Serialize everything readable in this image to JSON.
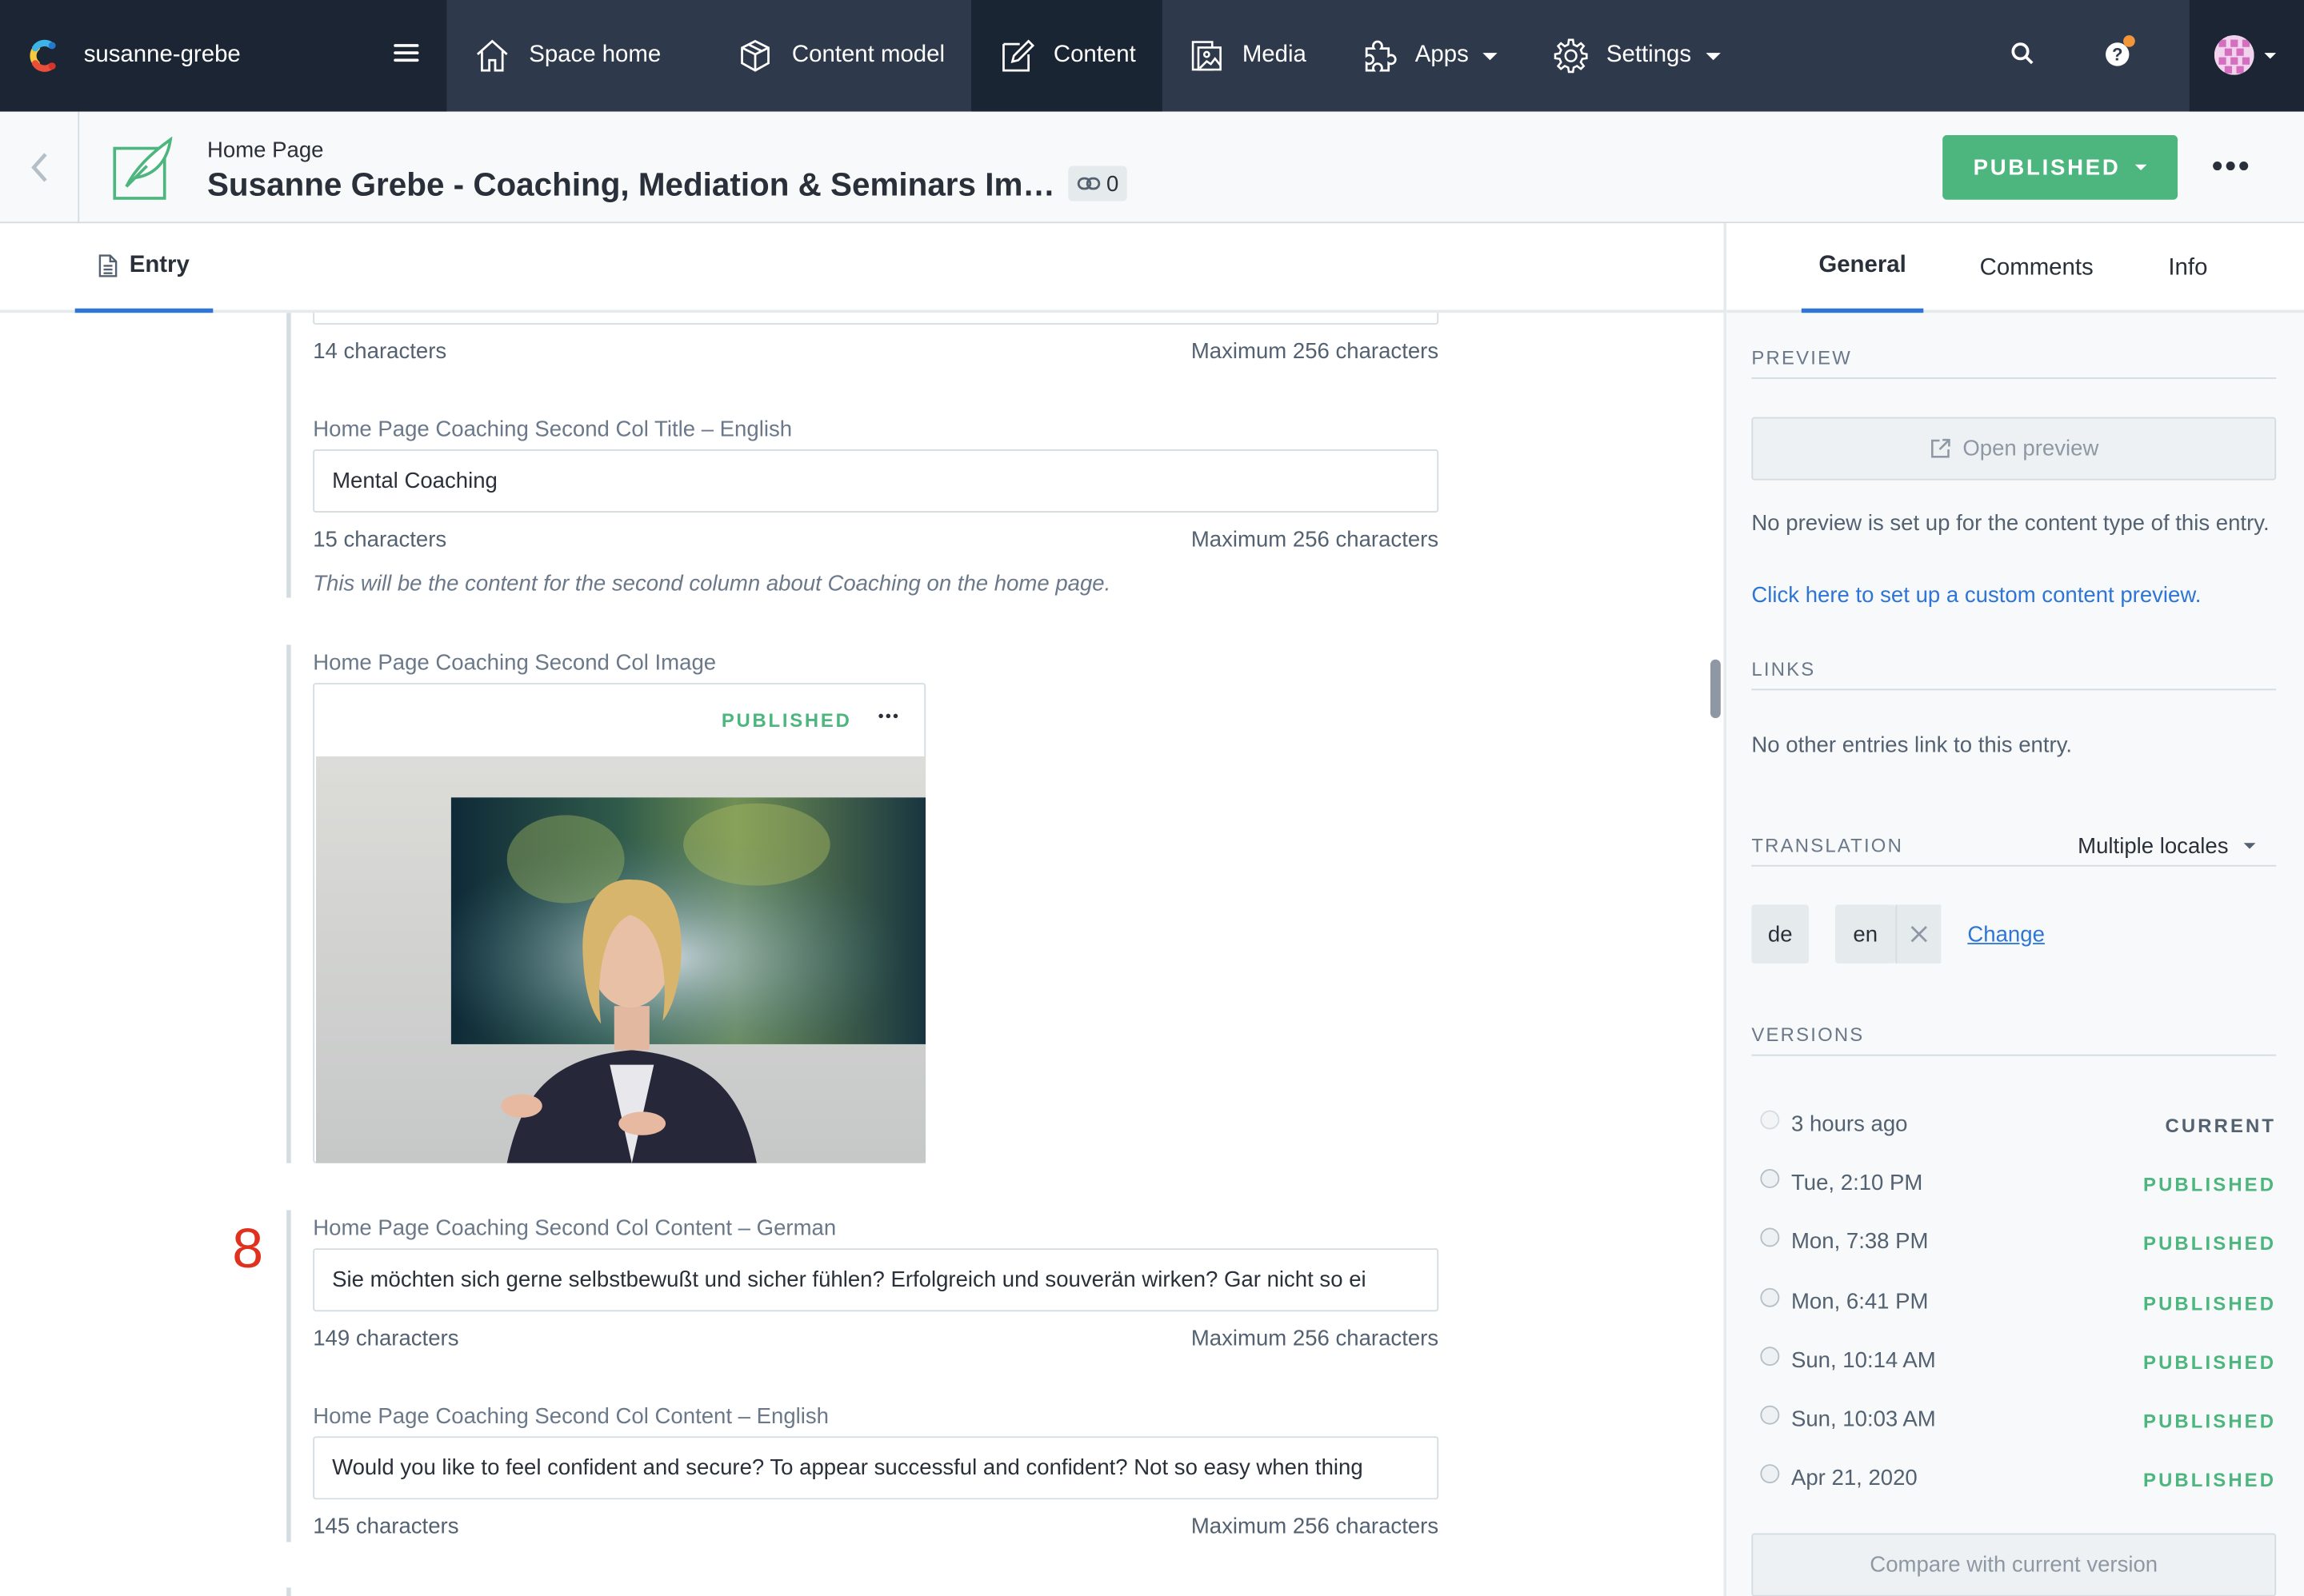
{
  "nav": {
    "space_name": "susanne-grebe",
    "items": [
      {
        "label": "Space home",
        "icon": "house-icon"
      },
      {
        "label": "Content model",
        "icon": "cube-icon"
      },
      {
        "label": "Content",
        "icon": "pencil-square-icon",
        "active": true
      },
      {
        "label": "Media",
        "icon": "image-icon"
      },
      {
        "label": "Apps",
        "icon": "puzzle-icon",
        "dropdown": true
      },
      {
        "label": "Settings",
        "icon": "gear-icon",
        "dropdown": true
      }
    ]
  },
  "header": {
    "content_type": "Home Page",
    "title": "Susanne Grebe - Coaching, Mediation & Seminars Im…",
    "link_count": "0",
    "status": "PUBLISHED"
  },
  "tabs": {
    "entry": "Entry"
  },
  "fields": {
    "first_count": "14 characters",
    "max": "Maximum 256 characters",
    "title_en_label": "Home Page Coaching Second Col Title – English",
    "title_en_value": "Mental Coaching",
    "title_en_count": "15 characters",
    "title_help": "This will be the content for the second column about Coaching on the home page.",
    "image_label": "Home Page Coaching Second Col Image",
    "image_status": "PUBLISHED",
    "step_number": "8",
    "content_de_label": "Home Page Coaching Second Col Content – German",
    "content_de_value": "Sie möchten sich gerne selbstbewußt und sicher fühlen? Erfolgreich und souverän wirken? Gar nicht so ei",
    "content_de_count": "149 characters",
    "content_en_label": "Home Page Coaching Second Col Content – English",
    "content_en_value": "Would you like to feel confident and secure? To appear successful and confident? Not so easy when thing",
    "content_en_count": "145 characters"
  },
  "sidebar": {
    "tabs": [
      "General",
      "Comments",
      "Info"
    ],
    "preview": {
      "heading": "PREVIEW",
      "button": "Open preview",
      "note": "No preview is set up for the content type of this entry.",
      "link": "Click here to set up a custom content preview."
    },
    "links": {
      "heading": "LINKS",
      "text": "No other entries link to this entry."
    },
    "translation": {
      "heading": "TRANSLATION",
      "select": "Multiple locales",
      "locales": [
        "de",
        "en"
      ],
      "change": "Change"
    },
    "versions": {
      "heading": "VERSIONS",
      "items": [
        {
          "date": "3 hours ago",
          "status": "CURRENT"
        },
        {
          "date": "Tue, 2:10 PM",
          "status": "PUBLISHED"
        },
        {
          "date": "Mon, 7:38 PM",
          "status": "PUBLISHED"
        },
        {
          "date": "Mon, 6:41 PM",
          "status": "PUBLISHED"
        },
        {
          "date": "Sun, 10:14 AM",
          "status": "PUBLISHED"
        },
        {
          "date": "Sun, 10:03 AM",
          "status": "PUBLISHED"
        },
        {
          "date": "Apr 21, 2020",
          "status": "PUBLISHED"
        }
      ],
      "compare": "Compare with current version"
    }
  },
  "colors": {
    "nav_bg": "#2e3a4b",
    "accent": "#2e75d4",
    "published": "#4db67e",
    "step_number": "#e0301e"
  }
}
